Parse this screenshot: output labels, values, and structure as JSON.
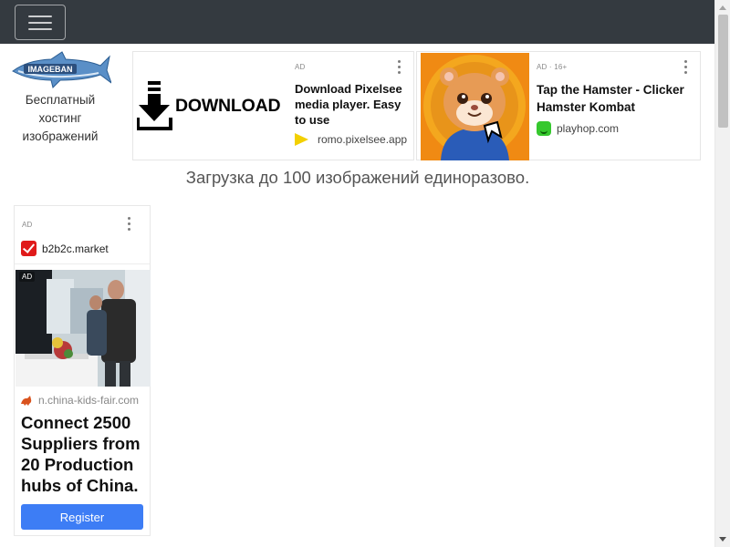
{
  "navbar": {
    "toggle_icon": "hamburger-icon"
  },
  "logo": {
    "icon": "shark-logo-icon",
    "brand_text": "IMAGEBAN",
    "caption": "Бесплатный хостинг изображений"
  },
  "ads": [
    {
      "label": "AD",
      "image_text": "DOWNLOAD",
      "title": "Download Pixelsee media player. Easy to use",
      "domain": "romo.pixelsee.app"
    },
    {
      "label": "AD · 16+",
      "title": "Tap the Hamster - Clicker Hamster Kombat",
      "domain": "playhop.com"
    },
    {
      "label": "AD",
      "brand": "b2b2c.market",
      "photo_label": "AD",
      "site": "n.china-kids-fair.com",
      "headline": "Connect 2500 Suppliers from 20 Production hubs of China.",
      "button": "Register"
    }
  ],
  "tagline": "Загрузка до 100 изображений единоразово.",
  "colors": {
    "navbar": "#343a40",
    "register_button": "#3d7df5",
    "brand_check": "#e01a1a"
  }
}
